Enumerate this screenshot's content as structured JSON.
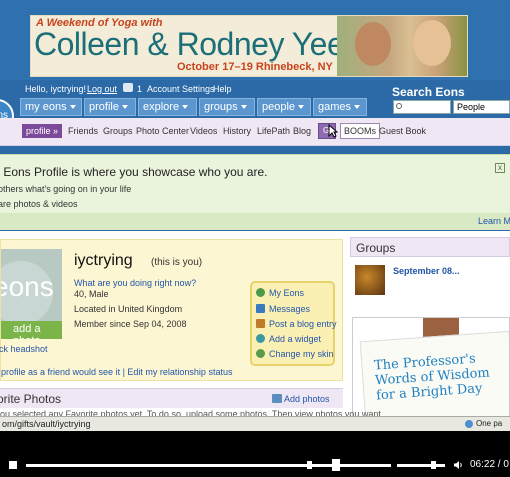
{
  "banner": {
    "topline": "A Weekend of Yoga with",
    "names": "Colleen & Rodney Yee",
    "dates": "October 17–19  Rhinebeck, NY"
  },
  "userbar": {
    "greeting": "Hello, iyctrying!",
    "logout": "Log out",
    "notif_count": "1",
    "account_settings": "Account Settings",
    "help": "Help"
  },
  "logo_text": "ns",
  "nav": {
    "tabs": [
      "my eons",
      "profile",
      "explore",
      "groups",
      "people",
      "games"
    ]
  },
  "search": {
    "title": "Search Eons",
    "placeholder": "",
    "scope": "People"
  },
  "subnav": {
    "items": [
      "profile",
      "Friends",
      "Groups",
      "Photo Center",
      "Videos",
      "History",
      "LifePath",
      "Blog",
      "Gi",
      "BOOMs",
      "Guest Book"
    ]
  },
  "intro": {
    "title": "r Eons Profile is where you showcase who you are.",
    "line1": "others what's going on in your life",
    "line2": "are photos & videos",
    "close": "x",
    "learn_more": "Learn Mo"
  },
  "profile": {
    "avatar_text": "eons",
    "add_photo": "add a photo",
    "headshot_link": "ck headshot",
    "username": "iyctrying",
    "you_note": "(this is you)",
    "status_question": "What are you doing right now?",
    "age_sex": "40, Male",
    "location": "Located in United Kingdom",
    "member_since": "Member since Sep 04, 2008",
    "view_links": "profile as a friend would see it | Edit my relationship status"
  },
  "actions": {
    "items": [
      "My Eons",
      "Messages",
      "Post a blog entry",
      "Add a widget",
      "Change my skin"
    ],
    "colors": [
      "#4a9a4a",
      "#3a7ac0",
      "#c07a2a",
      "#3a9aa0",
      "#5a9a4a"
    ]
  },
  "photos": {
    "title": "orite Photos",
    "add": "Add photos",
    "empty_text": "ou selected any Favorite photos yet. To do so, upload some photos. Then view photos you want"
  },
  "groups": {
    "title": "Groups",
    "group_name": "September 08...",
    "ad_text_1": "The Professor's",
    "ad_text_2": "Words of Wisdom",
    "ad_text_3": "for a Bright Day"
  },
  "statusbar": {
    "url": "om/gifts/vault/iyctrying",
    "right": "One pa"
  },
  "video": {
    "time": "06:22 / 0",
    "progress": 0.85,
    "volume": 0.75
  }
}
